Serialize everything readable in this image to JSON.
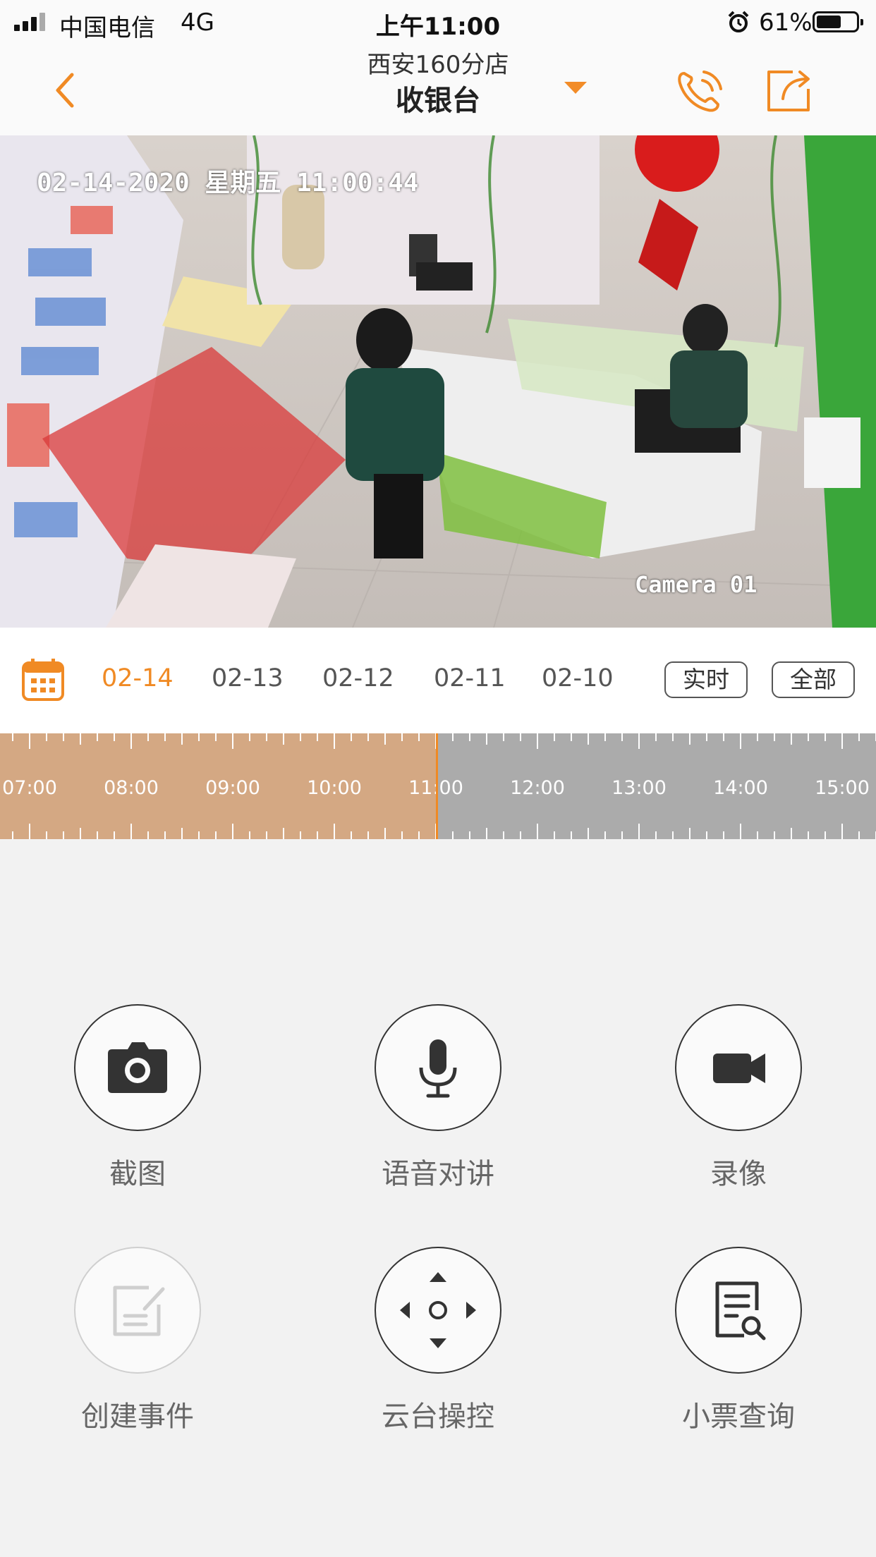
{
  "status_bar": {
    "carrier": "中国电信",
    "network": "4G",
    "time": "上午11:00",
    "battery": "61%"
  },
  "nav": {
    "store": "西安160分店",
    "channel": "收银台"
  },
  "video": {
    "osd_timestamp": "02-14-2020 星期五 11:00:44",
    "osd_camera": "Camera 01"
  },
  "date_bar": {
    "dates": [
      "02-14",
      "02-13",
      "02-12",
      "02-11",
      "02-10"
    ],
    "active_index": 0,
    "live_label": "实时",
    "all_label": "全部"
  },
  "timeline": {
    "labels": [
      "07:00",
      "08:00",
      "09:00",
      "10:00",
      "11:00",
      "12:00",
      "13:00",
      "14:00",
      "15:00"
    ],
    "current_time": "11:00"
  },
  "controls": [
    {
      "label": "截图",
      "icon": "camera-icon",
      "enabled": true
    },
    {
      "label": "语音对讲",
      "icon": "microphone-icon",
      "enabled": true
    },
    {
      "label": "录像",
      "icon": "video-record-icon",
      "enabled": true
    },
    {
      "label": "创建事件",
      "icon": "edit-note-icon",
      "enabled": false
    },
    {
      "label": "云台操控",
      "icon": "ptz-direction-icon",
      "enabled": true
    },
    {
      "label": "小票查询",
      "icon": "receipt-search-icon",
      "enabled": true
    }
  ],
  "colors": {
    "accent": "#f08a24",
    "timeline_played": "#d4a883",
    "timeline_remaining": "#ababab"
  }
}
